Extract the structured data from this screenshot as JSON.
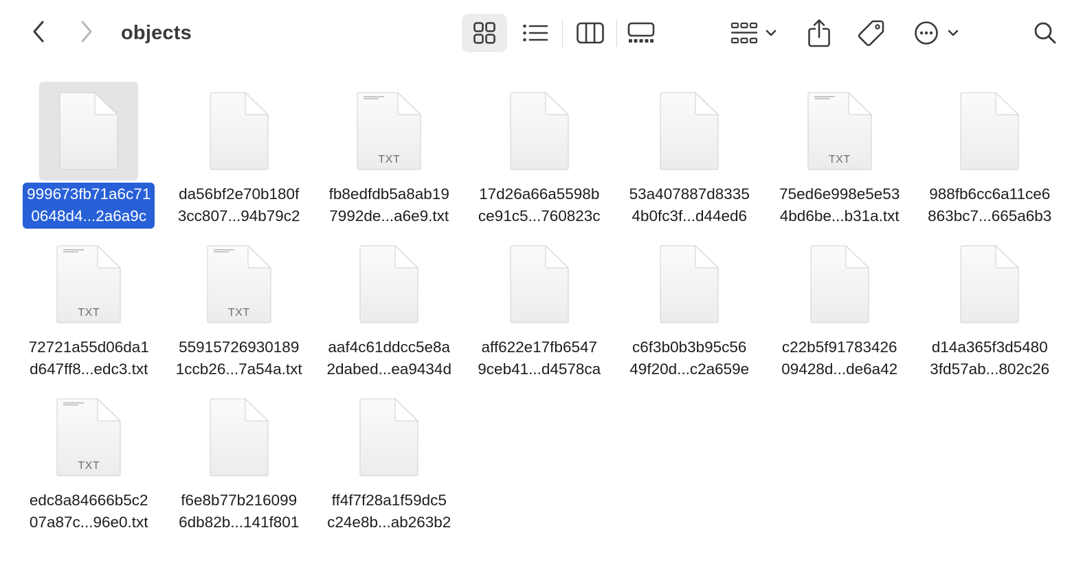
{
  "window": {
    "title": "objects"
  },
  "toolbar": {
    "back_icon": "chevron-left-icon",
    "forward_icon": "chevron-right-icon",
    "views": [
      "icon-view",
      "list-view",
      "column-view",
      "gallery-view"
    ],
    "active_view": "icon-view",
    "accent": "#2860d8"
  },
  "files": [
    {
      "line1": "999673fb71a6c71",
      "line2": "0648d4...2a6a9c",
      "ext": "",
      "selected": true
    },
    {
      "line1": "da56bf2e70b180f",
      "line2": "3cc807...94b79c2",
      "ext": ""
    },
    {
      "line1": "fb8edfdb5a8ab19",
      "line2": "7992de...a6e9.txt",
      "ext": "TXT"
    },
    {
      "line1": "17d26a66a5598b",
      "line2": "ce91c5...760823c",
      "ext": ""
    },
    {
      "line1": "53a407887d8335",
      "line2": "4b0fc3f...d44ed6",
      "ext": ""
    },
    {
      "line1": "75ed6e998e5e53",
      "line2": "4bd6be...b31a.txt",
      "ext": "TXT"
    },
    {
      "line1": "988fb6cc6a11ce6",
      "line2": "863bc7...665a6b3",
      "ext": ""
    },
    {
      "line1": "72721a55d06da1",
      "line2": "d647ff8...edc3.txt",
      "ext": "TXT"
    },
    {
      "line1": "55915726930189",
      "line2": "1ccb26...7a54a.txt",
      "ext": "TXT"
    },
    {
      "line1": "aaf4c61ddcc5e8a",
      "line2": "2dabed...ea9434d",
      "ext": ""
    },
    {
      "line1": "aff622e17fb6547",
      "line2": "9ceb41...d4578ca",
      "ext": ""
    },
    {
      "line1": "c6f3b0b3b95c56",
      "line2": "49f20d...c2a659e",
      "ext": ""
    },
    {
      "line1": "c22b5f91783426",
      "line2": "09428d...de6a42",
      "ext": ""
    },
    {
      "line1": "d14a365f3d5480",
      "line2": "3fd57ab...802c26",
      "ext": ""
    },
    {
      "line1": "edc8a84666b5c2",
      "line2": "07a87c...96e0.txt",
      "ext": "TXT"
    },
    {
      "line1": "f6e8b77b216099",
      "line2": "6db82b...141f801",
      "ext": ""
    },
    {
      "line1": "ff4f7f28a1f59dc5",
      "line2": "c24e8b...ab263b2",
      "ext": ""
    }
  ]
}
